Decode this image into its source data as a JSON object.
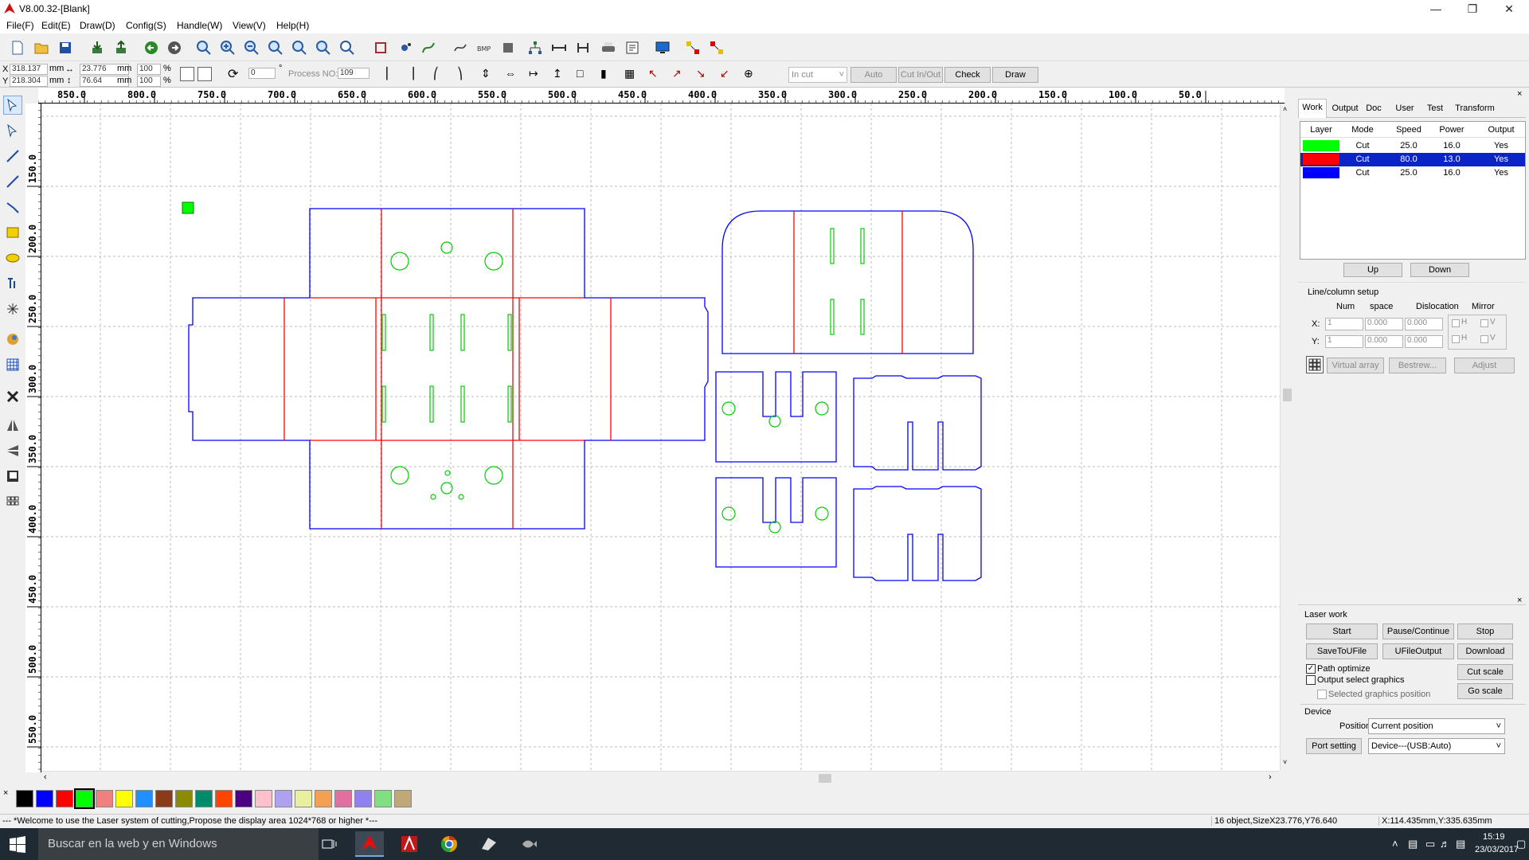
{
  "window": {
    "title": "V8.00.32-[Blank]"
  },
  "menu": [
    {
      "label": "File(F)"
    },
    {
      "label": "Edit(E)"
    },
    {
      "label": "Draw(D)"
    },
    {
      "label": "Config(S)"
    },
    {
      "label": "Handle(W)"
    },
    {
      "label": "View(V)"
    },
    {
      "label": "Help(H)"
    }
  ],
  "coords": {
    "x_label": "X",
    "y_label": "Y",
    "x_value": "318.137",
    "y_value": "218.304",
    "unit": "mm",
    "width_value": "23.776",
    "height_value": "76.64",
    "scale_x": "100",
    "scale_y": "100",
    "percent": "%",
    "rotate_value": "0",
    "rotate_unit": "°",
    "process_label": "Process NO:",
    "process_value": "109"
  },
  "toolbar2": {
    "in_cut": "In cut",
    "auto": "Auto",
    "cut_in_out": "Cut In/Out",
    "check": "Check",
    "draw": "Draw"
  },
  "ruler_top": [
    "850.0",
    "800.0",
    "750.0",
    "700.0",
    "650.0",
    "600.0",
    "550.0",
    "500.0",
    "450.0",
    "400.0",
    "350.0",
    "300.0",
    "250.0",
    "200.0",
    "150.0",
    "100.0",
    "50.0"
  ],
  "ruler_left": [
    "150.0",
    "200.0",
    "250.0",
    "300.0",
    "350.0",
    "400.0",
    "450.0",
    "500.0",
    "550.0"
  ],
  "palette": [
    "#000000",
    "#0000ff",
    "#ff0000",
    "#00ff00",
    "#f08080",
    "#ffff00",
    "#1e90ff",
    "#8b3a1a",
    "#8b8b00",
    "#008b6b",
    "#ff4500",
    "#4b0082",
    "#ffc0cb",
    "#b0a0f0",
    "#e8f0a0",
    "#f5a050",
    "#e070a0",
    "#9080f0",
    "#80e080",
    "#c0a878"
  ],
  "status": {
    "message": "--- *Welcome to use the Laser system of cutting,Propose the display area 1024*768 or higher *---",
    "objects": "16 object,SizeX23.776,Y76.640",
    "position": "X:114.435mm,Y:335.635mm"
  },
  "panel": {
    "tabs": [
      "Work",
      "Output",
      "Doc",
      "User",
      "Test",
      "Transform"
    ],
    "columns": [
      "Layer",
      "Mode",
      "Speed",
      "Power",
      "Output"
    ],
    "layers": [
      {
        "color": "#00ff00",
        "mode": "Cut",
        "speed": "25.0",
        "power": "16.0",
        "output": "Yes"
      },
      {
        "color": "#ff0000",
        "mode": "Cut",
        "speed": "80.0",
        "power": "13.0",
        "output": "Yes"
      },
      {
        "color": "#0000ff",
        "mode": "Cut",
        "speed": "25.0",
        "power": "16.0",
        "output": "Yes"
      }
    ],
    "up": "Up",
    "down": "Down",
    "line_column_setup": "Line/column setup",
    "num": "Num",
    "space": "space",
    "dislocation": "Dislocation",
    "mirror": "Mirror",
    "x_label": "X:",
    "y_label": "Y:",
    "x_num": "1",
    "x_space": "0.000",
    "x_disl": "0.000",
    "y_num": "1",
    "y_space": "0.000",
    "y_disl": "0.000",
    "h": "H",
    "v": "V",
    "virtual_array": "Virtual array",
    "bestrew": "Bestrew...",
    "adjust": "Adjust",
    "laser_work": "Laser work",
    "start": "Start",
    "pause": "Pause/Continue",
    "stop": "Stop",
    "save_to_ufile": "SaveToUFile",
    "ufile_output": "UFileOutput",
    "download": "Download",
    "path_optimize": "Path optimize",
    "output_select": "Output select graphics",
    "selected_pos": "Selected graphics position",
    "cut_scale": "Cut scale",
    "go_scale": "Go scale",
    "device": "Device",
    "position_label": "Position:",
    "position_value": "Current position",
    "port_setting": "Port setting",
    "device_value": "Device---(USB:Auto)"
  },
  "taskbar": {
    "search": "Buscar en la web y en Windows",
    "time": "15:19",
    "date": "23/03/2017"
  }
}
